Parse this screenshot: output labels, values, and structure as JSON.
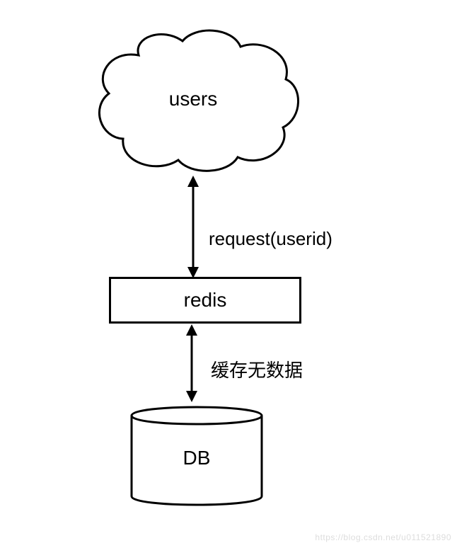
{
  "nodes": {
    "users": {
      "label": "users"
    },
    "redis": {
      "label": "redis"
    },
    "db": {
      "label": "DB"
    }
  },
  "edges": {
    "users_redis": {
      "label": "request(userid)"
    },
    "redis_db": {
      "label": "缓存无数据"
    }
  },
  "watermark": "https://blog.csdn.net/u011521890"
}
